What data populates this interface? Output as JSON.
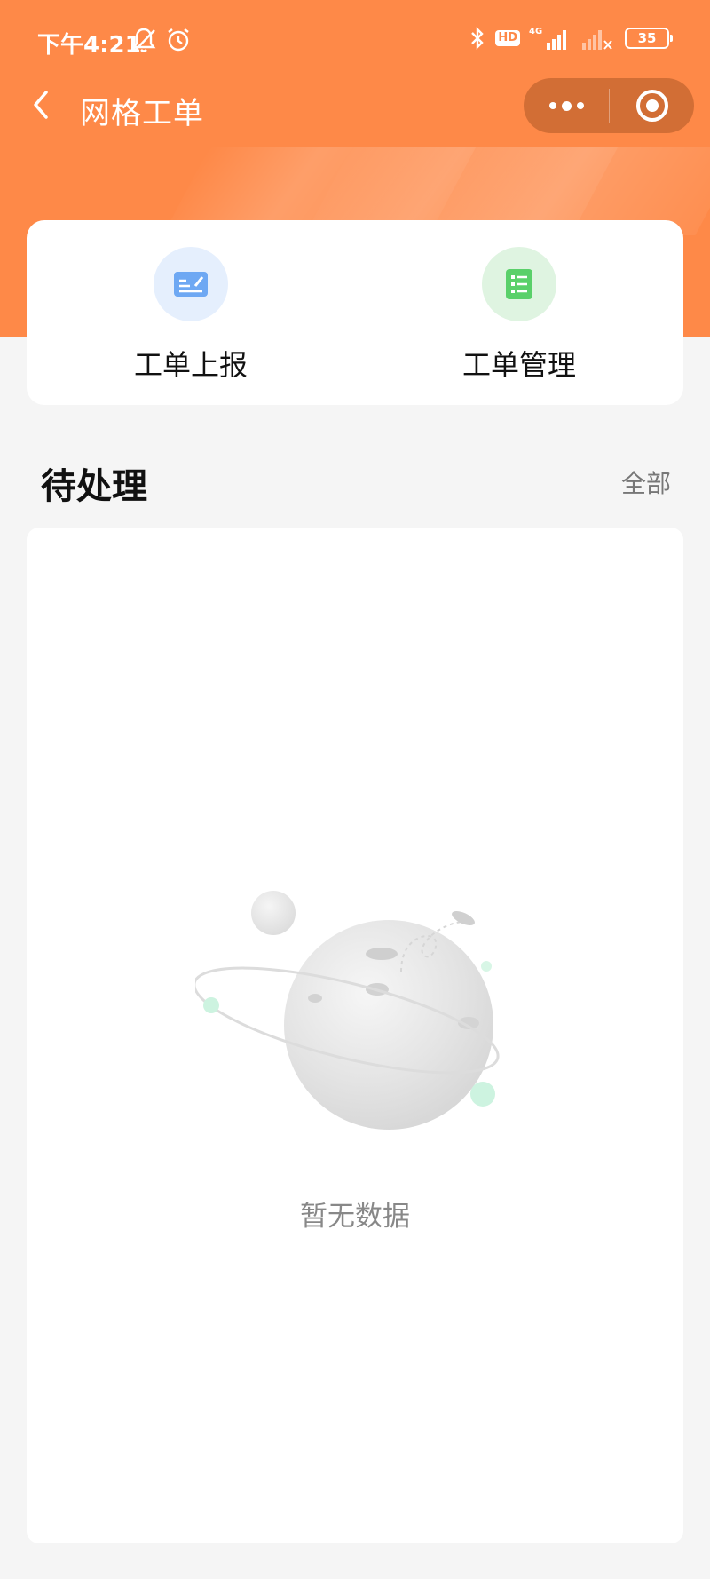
{
  "status_bar": {
    "time": "下午4:21",
    "network": "4G",
    "hd": "HD",
    "battery": "35"
  },
  "nav": {
    "title": "网格工单"
  },
  "actions": [
    {
      "label": "工单上报",
      "icon": "report-edit-icon",
      "color": "#5b9cf0"
    },
    {
      "label": "工单管理",
      "icon": "list-manage-icon",
      "color": "#4ccb5c"
    }
  ],
  "section": {
    "title": "待处理",
    "more_label": "全部"
  },
  "empty_state": {
    "text": "暂无数据",
    "illustration": "planet-empty-illustration"
  },
  "colors": {
    "brand": "#fe8948",
    "background": "#f5f5f5"
  }
}
